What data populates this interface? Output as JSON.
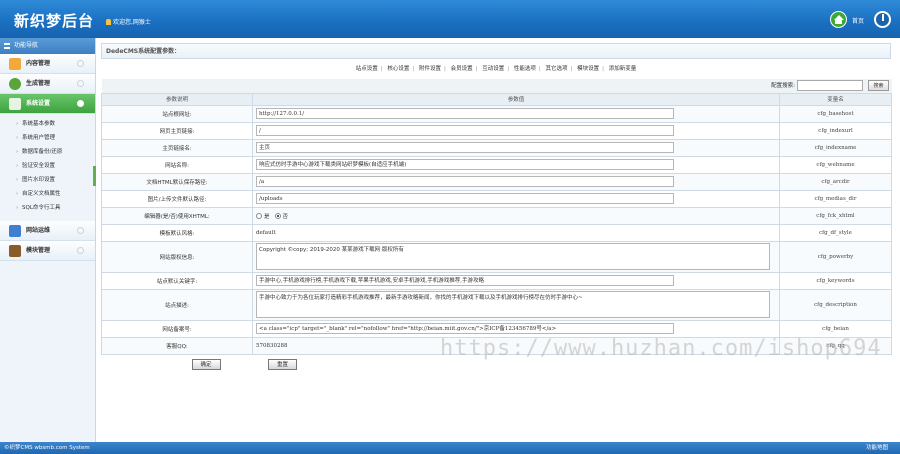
{
  "header": {
    "logo": "新织梦后台",
    "welcome": "欢迎您,网猴士",
    "home_label": "首页"
  },
  "sidebar": {
    "title": "功能导航",
    "menus": [
      {
        "label": "内容管理",
        "icon": "pencil-icon",
        "color": "#f3a83b"
      },
      {
        "label": "生成管理",
        "icon": "tree-icon",
        "color": "#5aa53a"
      },
      {
        "label": "系统设置",
        "icon": "settings-icon",
        "color": "#ffffff",
        "active": true
      }
    ],
    "submenu": [
      "系统基本参数",
      "系统用户管理",
      "数据库备份/还原",
      "验证安全设置",
      "图片水印设置",
      "自定义文档属性",
      "SQL命令行工具"
    ],
    "menus2": [
      {
        "label": "网站运维",
        "icon": "monitor-icon",
        "color": "#3f7fcf"
      },
      {
        "label": "模块管理",
        "icon": "module-icon",
        "color": "#8a5a2b"
      }
    ]
  },
  "main": {
    "title": "DedeCMS系统配置参数：",
    "tabs": [
      "站点设置",
      "核心设置",
      "附件设置",
      "会员设置",
      "互动设置",
      "性能选项",
      "其它选项",
      "模块设置",
      "添加新变量"
    ],
    "search_label": "配置搜索:",
    "search_value": "",
    "search_button": "搜索",
    "columns": [
      "参数说明",
      "参数值",
      "变量名"
    ],
    "rows": [
      {
        "label": "站点根网址:",
        "value": "http://127.0.0.1/",
        "var": "cfg_basehost",
        "kind": "input"
      },
      {
        "label": "网页主页链接:",
        "value": "/",
        "var": "cfg_indexurl",
        "kind": "input"
      },
      {
        "label": "主页链接名:",
        "value": "主页",
        "var": "cfg_indexname",
        "kind": "input"
      },
      {
        "label": "网站名称:",
        "value": "响应式仿时手游中心游戏下载类网站织梦模板(自适应手机端)",
        "var": "cfg_webname",
        "kind": "input"
      },
      {
        "label": "文档HTML默认保存路径:",
        "value": "/a",
        "var": "cfg_arcdir",
        "kind": "input"
      },
      {
        "label": "图片/上传文件默认路径:",
        "value": "/uploads",
        "var": "cfg_medias_dir",
        "kind": "input"
      },
      {
        "label": "编辑器(是/否)使用XHTML:",
        "value": "",
        "var": "cfg_fck_xhtml",
        "kind": "radio",
        "opt_yes": "是",
        "opt_no": "否"
      },
      {
        "label": "模板默认风格:",
        "value": "default",
        "var": "cfg_df_style",
        "kind": "plain"
      },
      {
        "label": "网站版权信息:",
        "value": "Copyright ©copy; 2019-2020 某某游戏下载网 版权所有",
        "var": "cfg_powerby",
        "kind": "textarea"
      },
      {
        "label": "站点默认关键字:",
        "value": "手游中心,手机游戏排行榜,手机游戏下载,苹果手机游戏,安卓手机游戏,手机游戏推荐,手游攻略",
        "var": "cfg_keywords",
        "kind": "input"
      },
      {
        "label": "站点描述:",
        "value": "手游中心致力于为各位玩家打造精彩手机游戏推荐，最新手游攻略新闻，你找的手机游戏下载以及手机游戏排行榜尽在仿时手游中心~",
        "var": "cfg_description",
        "kind": "textarea"
      },
      {
        "label": "网站备案号:",
        "value": "<a class=\"icp\" target=\"_blank\" rel=\"nofollow\" href=\"http://beian.miit.gov.cn/\">京ICP备123456789号</a>",
        "var": "cfg_beian",
        "kind": "input"
      },
      {
        "label": "客服QQ:",
        "value": "570830288",
        "var": "cfg_qq",
        "kind": "plain"
      }
    ],
    "ok_button": "确定",
    "reset_button": "重置"
  },
  "watermark": "https://www.huzhan.com/ishop694",
  "footer": {
    "left": "©织梦CMS  wbsmb.com System",
    "right": "功能地图"
  }
}
